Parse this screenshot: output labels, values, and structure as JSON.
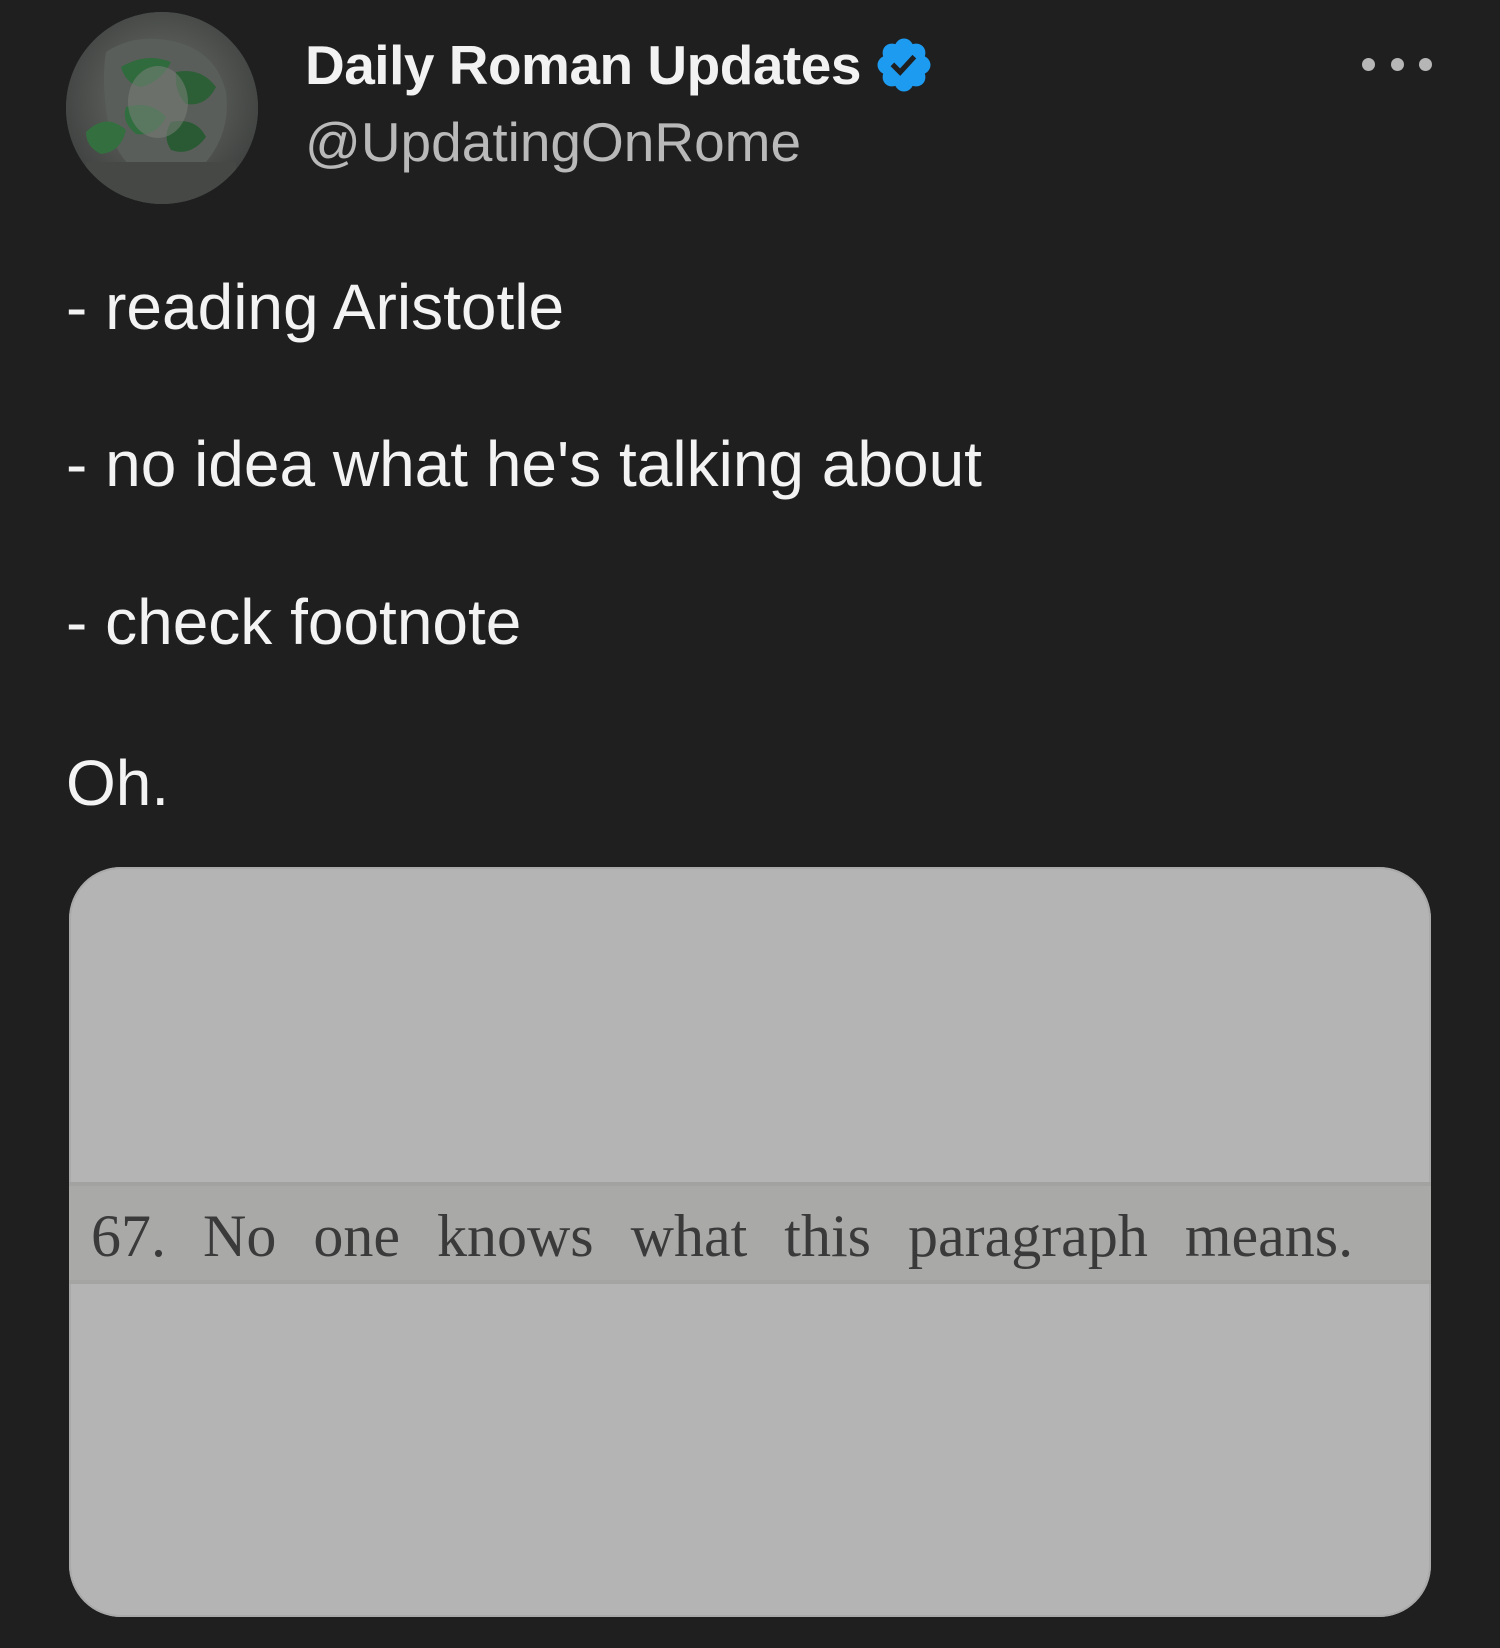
{
  "tweet": {
    "author": {
      "display_name": "Daily Roman Updates",
      "handle": "@UpdatingOnRome",
      "verified": true,
      "verified_badge_icon": "verified-check-icon",
      "avatar_icon": "statue-avatar"
    },
    "more_menu_icon": "ellipsis-icon",
    "body_lines": [
      "- reading Aristotle",
      "- no idea what he's talking about",
      "- check footnote",
      "Oh."
    ],
    "media": {
      "footnote_text": "67. No one knows what this paragraph means."
    }
  },
  "colors": {
    "background": "#1f1f20",
    "verified_blue": "#1d9bf0",
    "media_background": "#b4b4b4"
  }
}
